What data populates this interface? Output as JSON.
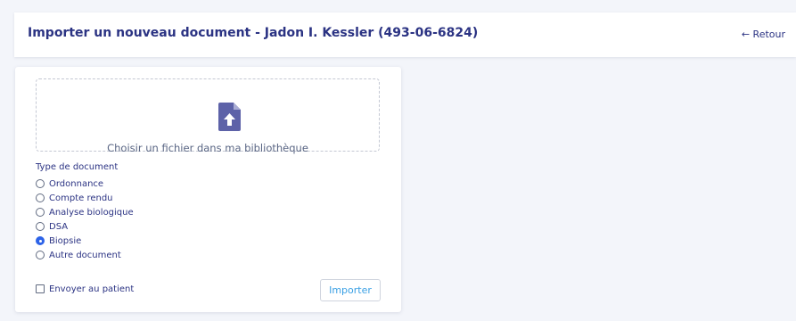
{
  "header": {
    "title": "Importer un nouveau document - Jadon I. Kessler (493-06-6824)",
    "back_label": "← Retour"
  },
  "dropzone": {
    "icon": "file-upload-icon",
    "label": "Choisir un fichier dans ma bibliothèque"
  },
  "document_type": {
    "label": "Type de document",
    "options": [
      {
        "label": "Ordonnance",
        "checked": false
      },
      {
        "label": "Compte rendu",
        "checked": false
      },
      {
        "label": "Analyse biologique",
        "checked": false
      },
      {
        "label": "DSA",
        "checked": false
      },
      {
        "label": "Biopsie",
        "checked": true
      },
      {
        "label": "Autre document",
        "checked": false
      }
    ]
  },
  "send_to_patient": {
    "label": "Envoyer au patient",
    "checked": false
  },
  "import_button": {
    "label": "Importer"
  },
  "colors": {
    "primary_text": "#2b3383",
    "accent_blue": "#3aa0e4",
    "icon_color": "#5d62a8",
    "radio_checked": "#2d63e8",
    "background": "#f3f5fa"
  }
}
